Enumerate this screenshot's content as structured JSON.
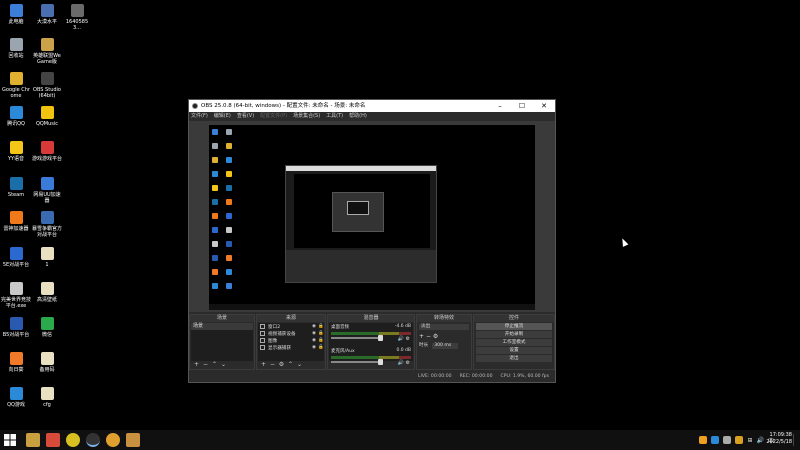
{
  "desktop": {
    "icons": [
      {
        "label": "此电脑",
        "color": "#3b7fd8"
      },
      {
        "label": "大漠水平",
        "color": "#4a6fb0"
      },
      {
        "label": "16405853...",
        "color": "#6a6a6a"
      },
      {
        "label": "回收站",
        "color": "#9aa5b0"
      },
      {
        "label": "英雄联盟WeGame版",
        "color": "#c9a24a"
      },
      {
        "label": "Google Chrome",
        "color": "#e0b030"
      },
      {
        "label": "OBS Studio (64bit)",
        "color": "#444444"
      },
      {
        "label": "腾讯QQ",
        "color": "#2a8ad8"
      },
      {
        "label": "QQMusic",
        "color": "#f2c40f"
      },
      {
        "label": "YY语音",
        "color": "#f5c518"
      },
      {
        "label": "游戏游戏平台",
        "color": "#d83a3a"
      },
      {
        "label": "Steam",
        "color": "#1b6fa8"
      },
      {
        "label": "网易UU加速器",
        "color": "#3a7ad8"
      },
      {
        "label": "雷神加速器",
        "color": "#f07a1a"
      },
      {
        "label": "暴雪争霸官方对战平台",
        "color": "#3a6ab0"
      },
      {
        "label": "5E对战平台",
        "color": "#2a6ad0"
      },
      {
        "label": "1",
        "color": "#e8e0c0"
      },
      {
        "label": "完美世界竞技平台.exe",
        "color": "#c8c8c8"
      },
      {
        "label": "高清壁纸",
        "color": "#e8e0c0"
      },
      {
        "label": "B5对战平台",
        "color": "#2a5ab0"
      },
      {
        "label": "微信",
        "color": "#2aaa4a"
      },
      {
        "label": "向日葵",
        "color": "#f07a2a"
      },
      {
        "label": "备用码",
        "color": "#e8e0c0"
      },
      {
        "label": "QQ游戏",
        "color": "#2a8ad8"
      },
      {
        "label": "cfg",
        "color": "#e8e0c0"
      }
    ]
  },
  "obs": {
    "title": "OBS 25.0.8 (64-bit, windows) - 配置文件: 未命名 - 场景: 未命名",
    "menu": [
      "文件(F)",
      "编辑(E)",
      "查看(V)",
      "配置文件(P)",
      "场景集合(S)",
      "工具(T)",
      "帮助(H)"
    ],
    "scenes": {
      "title": "场景",
      "items": [
        "场景"
      ]
    },
    "sources": {
      "title": "来源",
      "items": [
        "窗口2",
        "视频捕获设备",
        "图像",
        "显示器捕获"
      ]
    },
    "mixer": {
      "title": "混音器",
      "channels": [
        {
          "name": "桌面音频",
          "db": "-4.6 dB"
        },
        {
          "name": "麦克风/Aux",
          "db": "0.0 dB"
        }
      ]
    },
    "transitions": {
      "title": "转场特效",
      "selected": "淡出",
      "duration_label": "时长",
      "duration": "300 ms"
    },
    "controls": {
      "title": "控件",
      "buttons": [
        "停止推流",
        "开始录制",
        "工作室模式",
        "设置",
        "退出"
      ]
    },
    "status": {
      "live": "LIVE: 00:00:00",
      "rec": "REC: 00:00:00",
      "cpu": "CPU: 1.9%, 60.00 fps"
    }
  },
  "taskbar": {
    "time": "17:09:38",
    "date": "2022/5/18",
    "ime": "中"
  }
}
